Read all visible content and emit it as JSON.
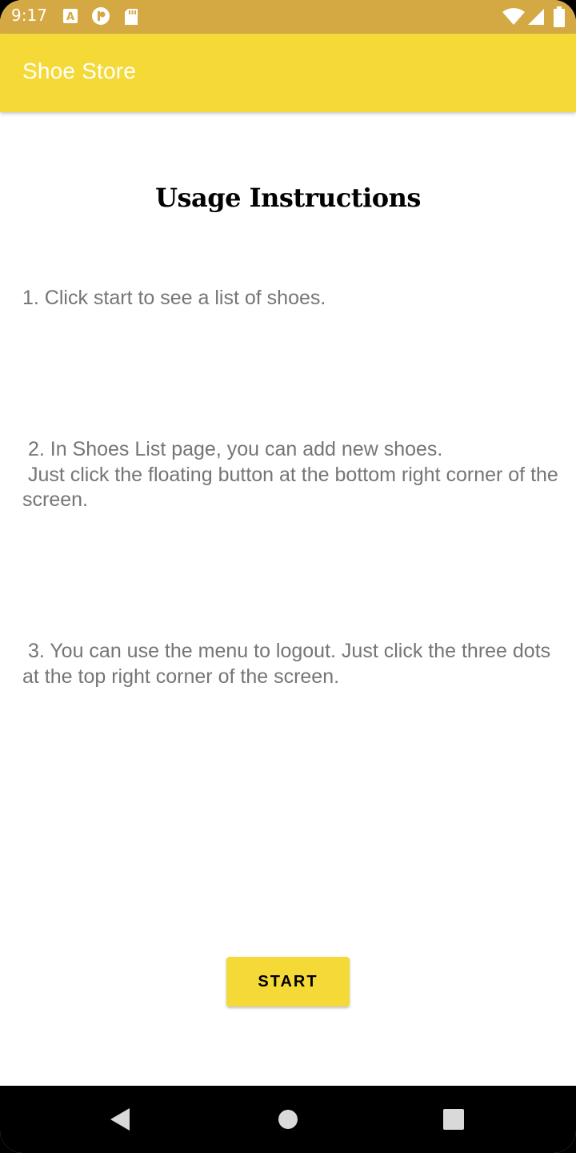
{
  "status_bar": {
    "time": "9:17",
    "icons_left": [
      "a-letter-icon",
      "circle-p-icon",
      "sd-card-icon"
    ],
    "icons_right": [
      "wifi-icon",
      "signal-icon",
      "battery-icon"
    ]
  },
  "app_bar": {
    "title": "Shoe Store",
    "color": "#f5d937"
  },
  "content": {
    "heading": "Usage Instructions",
    "step1": "1. Click start to see a list of shoes.",
    "step2": " 2. In Shoes List page, you can add new shoes.\n Just click the floating button at the bottom right corner of the screen.",
    "step3": " 3. You can use the menu to logout. Just click the three dots at the top right corner of the screen."
  },
  "start_button": {
    "label": "START",
    "color": "#f5d937"
  },
  "nav_bar": {
    "buttons": [
      "back-icon",
      "home-icon",
      "recents-icon"
    ]
  }
}
